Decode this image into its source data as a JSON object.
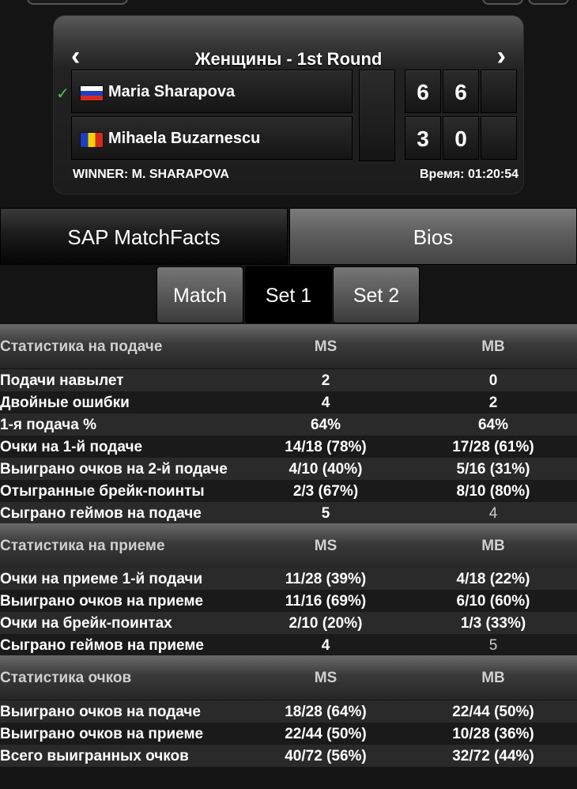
{
  "scorecard": {
    "title": "Женщины - 1st Round",
    "players": [
      {
        "name": "Maria Sharapova",
        "flag": "russia-flag-icon",
        "winner": true,
        "sets": [
          "6",
          "6"
        ]
      },
      {
        "name": "Mihaela Buzarnescu",
        "flag": "romania-flag-icon",
        "winner": false,
        "sets": [
          "3",
          "0"
        ]
      }
    ],
    "result": "WINNER: M. SHARAPOVA",
    "time": "Время: 01:20:54"
  },
  "tabs": [
    {
      "label": "SAP MatchFacts",
      "active": true
    },
    {
      "label": "Bios",
      "active": false
    }
  ],
  "subtabs": [
    {
      "label": "Match",
      "active": false
    },
    {
      "label": "Set 1",
      "active": true
    },
    {
      "label": "Set 2",
      "active": false
    }
  ],
  "sections": [
    {
      "title": "Статистика на подаче",
      "col1": "MS",
      "col2": "MB",
      "rows": [
        {
          "label": "Подачи навылет",
          "v1": "2",
          "v2": "0"
        },
        {
          "label": "Двойные ошибки",
          "v1": "4",
          "v2": "2"
        },
        {
          "label": "1-я подача %",
          "v1": "64%",
          "v2": "64%"
        },
        {
          "label": "Очки на 1-й подаче",
          "v1": "14/18 (78%)",
          "v2": "17/28 (61%)"
        },
        {
          "label": "Выиграно очков на 2-й подаче",
          "v1": "4/10 (40%)",
          "v2": "5/16 (31%)"
        },
        {
          "label": "Отыгранные брейк-поинты",
          "v1": "2/3 (67%)",
          "v2": "8/10 (80%)"
        },
        {
          "label": "Сыграно геймов на подаче",
          "v1": "5",
          "v2": "4"
        }
      ]
    },
    {
      "title": "Статистика на приеме",
      "col1": "MS",
      "col2": "MB",
      "rows": [
        {
          "label": "Очки на приеме 1-й подачи",
          "v1": "11/28 (39%)",
          "v2": "4/18 (22%)"
        },
        {
          "label": "Выиграно очков на приеме",
          "v1": "11/16 (69%)",
          "v2": "6/10 (60%)"
        },
        {
          "label": "Очки на брейк-поинтах",
          "v1": "2/10 (20%)",
          "v2": "1/3 (33%)"
        },
        {
          "label": "Сыграно геймов на приеме",
          "v1": "4",
          "v2": "5"
        }
      ]
    },
    {
      "title": "Статистика очков",
      "col1": "MS",
      "col2": "MB",
      "rows": [
        {
          "label": "Выиграно очков на подаче",
          "v1": "18/28 (64%)",
          "v2": "22/44 (50%)"
        },
        {
          "label": "Выиграно очков на приеме",
          "v1": "22/44 (50%)",
          "v2": "10/28 (36%)"
        },
        {
          "label": "Всего выигранных очков",
          "v1": "40/72 (56%)",
          "v2": "32/72 (44%)"
        }
      ]
    }
  ]
}
